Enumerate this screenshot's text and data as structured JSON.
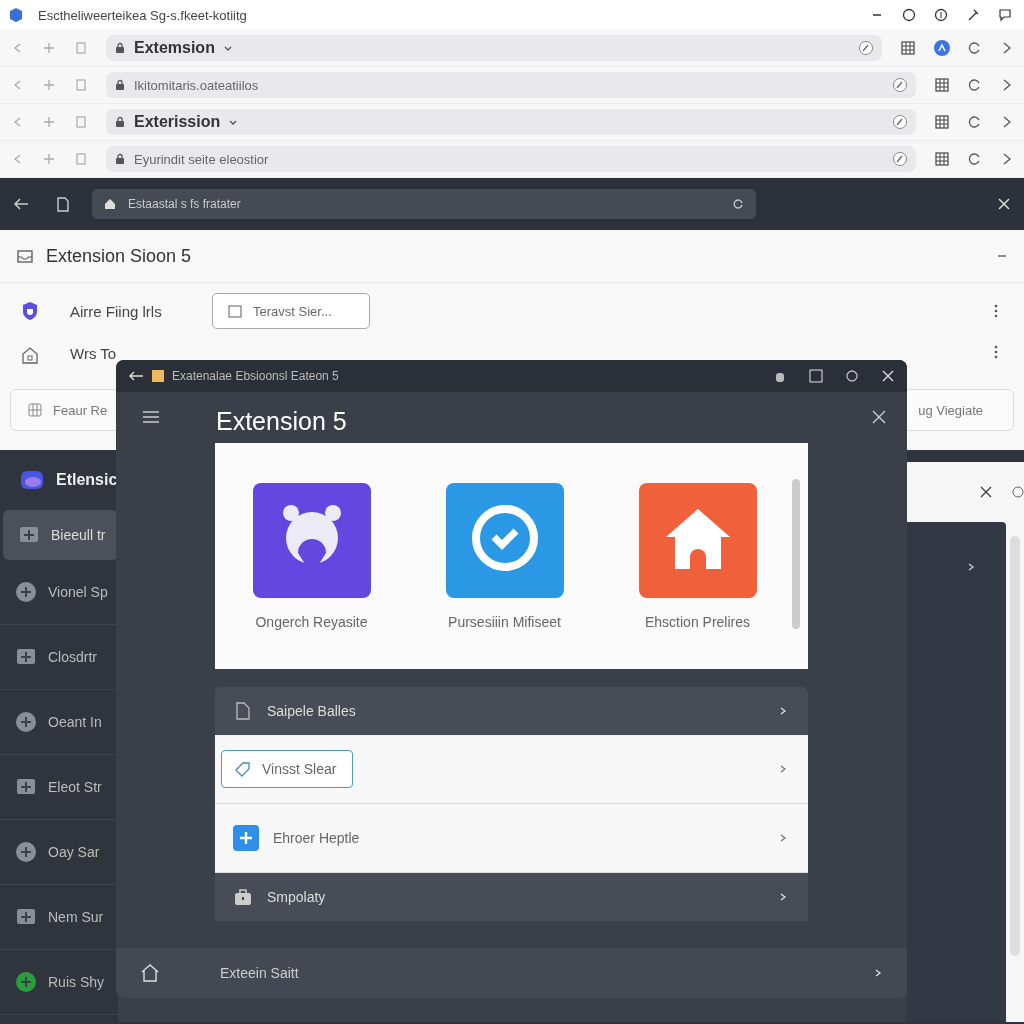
{
  "window": {
    "title": "Esctheliweerteikea Sg-s.fkeet-kotiitg"
  },
  "browser_rows": [
    {
      "kind": "tab",
      "text": "Extemsion"
    },
    {
      "kind": "address",
      "text": "Ikitomitaris.oateatiilos"
    },
    {
      "kind": "tab",
      "text": "Exterission"
    },
    {
      "kind": "address",
      "text": "Eyurindit seite eleostior"
    }
  ],
  "dark_bar": {
    "address": "Estaastal s fs fratater"
  },
  "panel": {
    "title": "Extension Sioon 5",
    "rows": [
      {
        "label": "Airre Fiing lrls",
        "button": "Teravst Sier..."
      },
      {
        "label": "Wrs To"
      }
    ],
    "search": {
      "placeholder": "Feaur Re",
      "trailing": "ug Viegiate"
    }
  },
  "sidebar": {
    "title": "Etlensic",
    "items": [
      {
        "label": "Bieeull tr",
        "selected": true
      },
      {
        "label": "Vionel Sp",
        "selected": false
      },
      {
        "label": "Closdrtr",
        "selected": false
      },
      {
        "label": "Oeant In",
        "selected": false
      },
      {
        "label": "Eleot Str",
        "selected": false
      },
      {
        "label": "Oay Sar",
        "selected": false
      },
      {
        "label": "Nem Sur",
        "selected": false
      },
      {
        "label": "Ruis Shy",
        "selected": false
      }
    ]
  },
  "modal": {
    "title": "Exatenalae Ebsioonsl Eateon 5",
    "heading": "Extension 5",
    "apps": [
      {
        "label": "Ongerch Reyasite",
        "color": "#6247e0"
      },
      {
        "label": "Pursesiiin Mifiseet",
        "color": "#2b98e6"
      },
      {
        "label": "Ehsction Prelires",
        "color": "#f0603a"
      }
    ],
    "list": [
      {
        "kind": "dark",
        "label": "Saipele Balles"
      },
      {
        "kind": "outlined",
        "label": "Vinsst Slear"
      },
      {
        "kind": "plus",
        "label": "Ehroer Heptle"
      },
      {
        "kind": "dark",
        "label": "Smpolaty"
      }
    ],
    "footer": "Exteein Saitt"
  }
}
